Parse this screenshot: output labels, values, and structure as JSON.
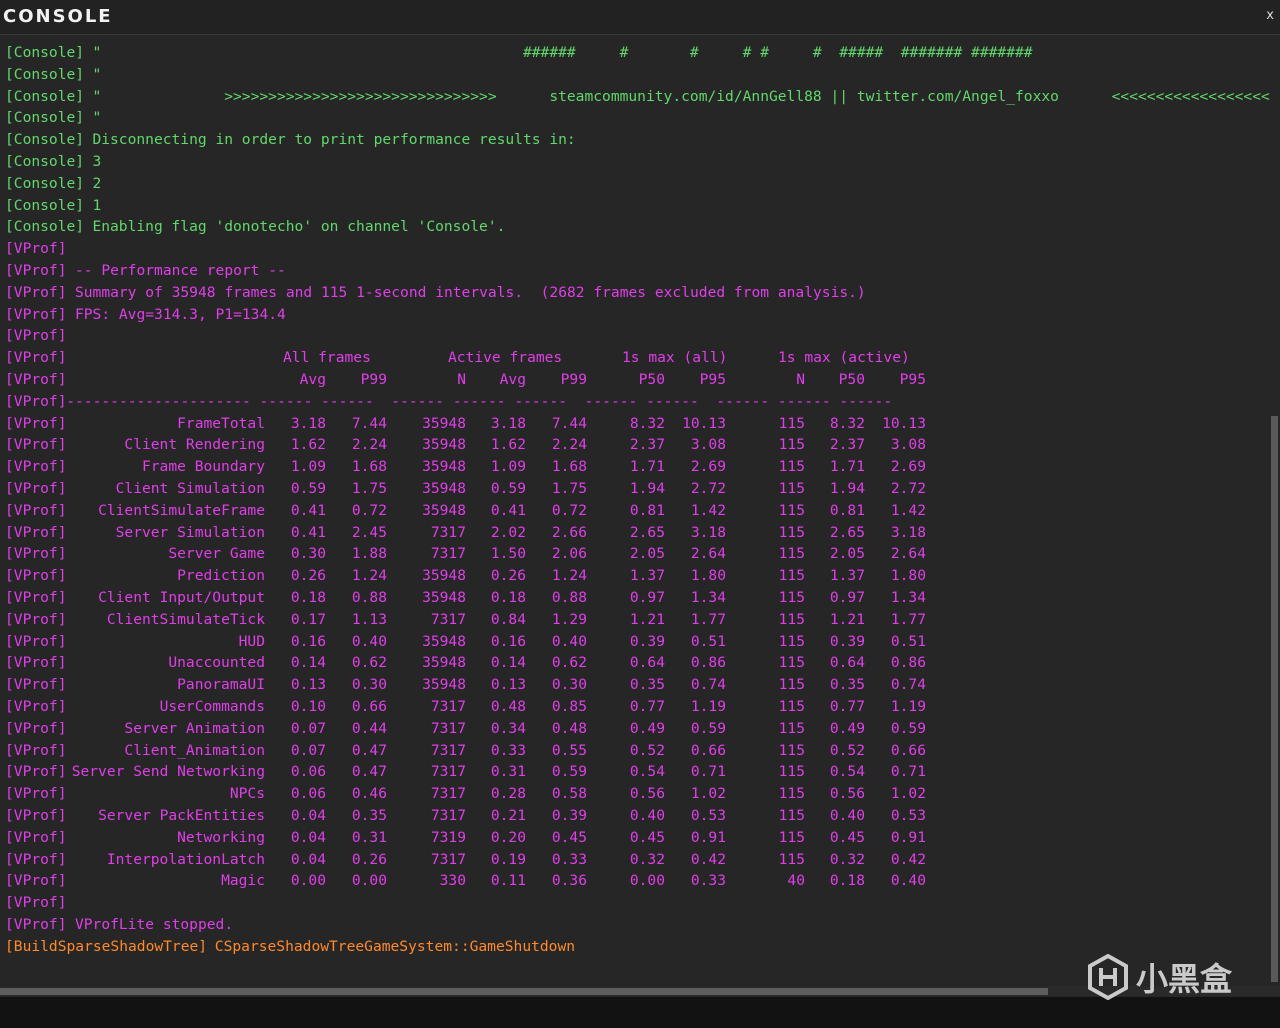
{
  "window": {
    "title": "CONSOLE",
    "close_glyph": "x"
  },
  "console_lines": [
    {
      "tag": "[Console]",
      "text": " \"                                                #     #    #       #     # #    ## #     # #       #"
    },
    {
      "tag": "[Console]",
      "text": " \"                                                ######     #       #     # #     #  #####  ####### #######"
    },
    {
      "tag": "[Console]",
      "text": " \""
    },
    {
      "tag": "[Console]",
      "text": " \"              >>>>>>>>>>>>>>>>>>>>>>>>>>>>>>>      steamcommunity.com/id/AnnGell88 || twitter.com/Angel_foxxo      <<<<<<<<<<<<<<<<<<<<<<<<<<<<<<<"
    },
    {
      "tag": "[Console]",
      "text": " \""
    },
    {
      "tag": "[Console]",
      "text": " Disconnecting in order to print performance results in:"
    },
    {
      "tag": "[Console]",
      "text": " 3"
    },
    {
      "tag": "[Console]",
      "text": " 2"
    },
    {
      "tag": "[Console]",
      "text": " 1"
    },
    {
      "tag": "[Console]",
      "text": " Enabling flag 'donotecho' on channel 'Console'."
    }
  ],
  "vprof_lines": [
    {
      "tag": "[VProf]",
      "text": ""
    },
    {
      "tag": "[VProf]",
      "text": " -- Performance report --"
    },
    {
      "tag": "[VProf]",
      "text": " Summary of 35948 frames and 115 1-second intervals.  (2682 frames excluded from analysis.)"
    },
    {
      "tag": "[VProf]",
      "text": " FPS: Avg=314.3, P1=134.4"
    },
    {
      "tag": "[VProf]",
      "text": ""
    }
  ],
  "vprof_table": {
    "tag": "[VProf]",
    "group_headers": [
      "All frames",
      "Active frames",
      "1s max (all)",
      "1s max (active)"
    ],
    "column_headers": [
      "Avg",
      "P99",
      "N",
      "Avg",
      "P99",
      "P50",
      "P95",
      "N",
      "P50",
      "P95"
    ],
    "separator": " --------------------- ------ ------  ------ ------ ------  ------ ------  ------ ------ ------",
    "rows": [
      {
        "name": "FrameTotal",
        "values": [
          "3.18",
          "7.44",
          "35948",
          "3.18",
          "7.44",
          "8.32",
          "10.13",
          "115",
          "8.32",
          "10.13"
        ]
      },
      {
        "name": "Client Rendering",
        "values": [
          "1.62",
          "2.24",
          "35948",
          "1.62",
          "2.24",
          "2.37",
          "3.08",
          "115",
          "2.37",
          "3.08"
        ]
      },
      {
        "name": "Frame Boundary",
        "values": [
          "1.09",
          "1.68",
          "35948",
          "1.09",
          "1.68",
          "1.71",
          "2.69",
          "115",
          "1.71",
          "2.69"
        ]
      },
      {
        "name": "Client Simulation",
        "values": [
          "0.59",
          "1.75",
          "35948",
          "0.59",
          "1.75",
          "1.94",
          "2.72",
          "115",
          "1.94",
          "2.72"
        ]
      },
      {
        "name": "ClientSimulateFrame",
        "values": [
          "0.41",
          "0.72",
          "35948",
          "0.41",
          "0.72",
          "0.81",
          "1.42",
          "115",
          "0.81",
          "1.42"
        ]
      },
      {
        "name": "Server Simulation",
        "values": [
          "0.41",
          "2.45",
          "7317",
          "2.02",
          "2.66",
          "2.65",
          "3.18",
          "115",
          "2.65",
          "3.18"
        ]
      },
      {
        "name": "Server Game",
        "values": [
          "0.30",
          "1.88",
          "7317",
          "1.50",
          "2.06",
          "2.05",
          "2.64",
          "115",
          "2.05",
          "2.64"
        ]
      },
      {
        "name": "Prediction",
        "values": [
          "0.26",
          "1.24",
          "35948",
          "0.26",
          "1.24",
          "1.37",
          "1.80",
          "115",
          "1.37",
          "1.80"
        ]
      },
      {
        "name": "Client Input/Output",
        "values": [
          "0.18",
          "0.88",
          "35948",
          "0.18",
          "0.88",
          "0.97",
          "1.34",
          "115",
          "0.97",
          "1.34"
        ]
      },
      {
        "name": "ClientSimulateTick",
        "values": [
          "0.17",
          "1.13",
          "7317",
          "0.84",
          "1.29",
          "1.21",
          "1.77",
          "115",
          "1.21",
          "1.77"
        ]
      },
      {
        "name": "HUD",
        "values": [
          "0.16",
          "0.40",
          "35948",
          "0.16",
          "0.40",
          "0.39",
          "0.51",
          "115",
          "0.39",
          "0.51"
        ]
      },
      {
        "name": "Unaccounted",
        "values": [
          "0.14",
          "0.62",
          "35948",
          "0.14",
          "0.62",
          "0.64",
          "0.86",
          "115",
          "0.64",
          "0.86"
        ]
      },
      {
        "name": "PanoramaUI",
        "values": [
          "0.13",
          "0.30",
          "35948",
          "0.13",
          "0.30",
          "0.35",
          "0.74",
          "115",
          "0.35",
          "0.74"
        ]
      },
      {
        "name": "UserCommands",
        "values": [
          "0.10",
          "0.66",
          "7317",
          "0.48",
          "0.85",
          "0.77",
          "1.19",
          "115",
          "0.77",
          "1.19"
        ]
      },
      {
        "name": "Server Animation",
        "values": [
          "0.07",
          "0.44",
          "7317",
          "0.34",
          "0.48",
          "0.49",
          "0.59",
          "115",
          "0.49",
          "0.59"
        ]
      },
      {
        "name": "Client_Animation",
        "values": [
          "0.07",
          "0.47",
          "7317",
          "0.33",
          "0.55",
          "0.52",
          "0.66",
          "115",
          "0.52",
          "0.66"
        ]
      },
      {
        "name": "Server Send Networking",
        "values": [
          "0.06",
          "0.47",
          "7317",
          "0.31",
          "0.59",
          "0.54",
          "0.71",
          "115",
          "0.54",
          "0.71"
        ]
      },
      {
        "name": "NPCs",
        "values": [
          "0.06",
          "0.46",
          "7317",
          "0.28",
          "0.58",
          "0.56",
          "1.02",
          "115",
          "0.56",
          "1.02"
        ]
      },
      {
        "name": "Server PackEntities",
        "values": [
          "0.04",
          "0.35",
          "7317",
          "0.21",
          "0.39",
          "0.40",
          "0.53",
          "115",
          "0.40",
          "0.53"
        ]
      },
      {
        "name": "Networking",
        "values": [
          "0.04",
          "0.31",
          "7319",
          "0.20",
          "0.45",
          "0.45",
          "0.91",
          "115",
          "0.45",
          "0.91"
        ]
      },
      {
        "name": "InterpolationLatch",
        "values": [
          "0.04",
          "0.26",
          "7317",
          "0.19",
          "0.33",
          "0.32",
          "0.42",
          "115",
          "0.32",
          "0.42"
        ]
      },
      {
        "name": "Magic",
        "values": [
          "0.00",
          "0.00",
          "330",
          "0.11",
          "0.36",
          "0.00",
          "0.33",
          "40",
          "0.18",
          "0.40"
        ]
      }
    ]
  },
  "footer_lines": [
    {
      "tag": "[VProf]",
      "text": "",
      "color": "vprof"
    },
    {
      "tag": "[VProf]",
      "text": " VProfLite stopped.",
      "color": "vprof"
    },
    {
      "tag": "[BuildSparseShadowTree]",
      "text": " CSparseShadowTreeGameSystem::GameShutdown",
      "color": "build"
    }
  ],
  "watermark": {
    "text": "小黑盒"
  },
  "colors": {
    "console": "#62d76c",
    "vprof": "#df3fe8",
    "build": "#ff8a2c",
    "background": "#262626"
  }
}
